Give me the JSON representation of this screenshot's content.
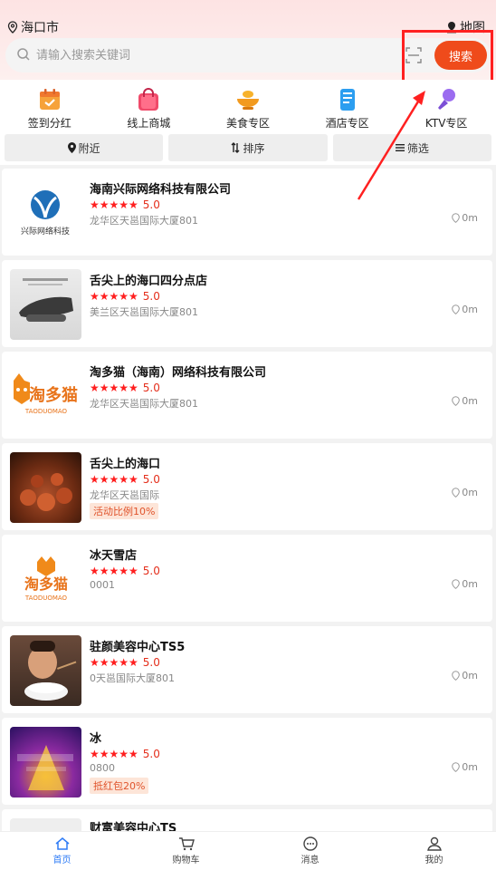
{
  "header": {
    "city": "海口市",
    "map_label": "地图",
    "search_placeholder": "请输入搜索关键词",
    "search_button": "搜索"
  },
  "categories": [
    {
      "label": "签到分红",
      "icon": "calendar-icon"
    },
    {
      "label": "线上商城",
      "icon": "shopping-bag-icon"
    },
    {
      "label": "美食专区",
      "icon": "food-bowl-icon"
    },
    {
      "label": "酒店专区",
      "icon": "hotel-building-icon"
    },
    {
      "label": "KTV专区",
      "icon": "microphone-icon"
    }
  ],
  "filters": [
    {
      "label": "附近",
      "icon": "location-pin-icon"
    },
    {
      "label": "排序",
      "icon": "sort-icon"
    },
    {
      "label": "筛选",
      "icon": "filter-icon"
    }
  ],
  "shops": [
    {
      "name": "海南兴际网络科技有限公司",
      "rating": "5.0",
      "address": "龙华区天邕国际大厦801",
      "distance": "0m",
      "tag": "",
      "logo_text": "兴际网络科技"
    },
    {
      "name": "舌尖上的海口四分点店",
      "rating": "5.0",
      "address": "美兰区天邕国际大厦801",
      "distance": "0m",
      "tag": ""
    },
    {
      "name": "淘多猫（海南）网络科技有限公司",
      "rating": "5.0",
      "address": "龙华区天邕国际大厦801",
      "distance": "0m",
      "tag": "",
      "logo_text": "淘多猫",
      "logo_sub": "TAODUOMAO"
    },
    {
      "name": "舌尖上的海口",
      "rating": "5.0",
      "address": "龙华区天邕国际",
      "distance": "0m",
      "tag": "活动比例10%"
    },
    {
      "name": "冰天雪店",
      "rating": "5.0",
      "address": "0001",
      "distance": "0m",
      "tag": "",
      "logo_text": "淘多猫",
      "logo_sub": "TAODUOMAO"
    },
    {
      "name": "驻颜美容中心TS5",
      "rating": "5.0",
      "address": "0天邕国际大厦801",
      "distance": "0m",
      "tag": ""
    },
    {
      "name": "冰",
      "rating": "5.0",
      "address": "0800",
      "distance": "0m",
      "tag": "抵红包20%"
    },
    {
      "name": "财富美容中心TS",
      "rating": "",
      "address": "",
      "distance": "",
      "tag": ""
    }
  ],
  "tabbar": [
    {
      "label": "首页",
      "icon": "home-icon",
      "active": true
    },
    {
      "label": "购物车",
      "icon": "cart-icon",
      "active": false
    },
    {
      "label": "消息",
      "icon": "message-icon",
      "active": false
    },
    {
      "label": "我的",
      "icon": "user-icon",
      "active": false
    }
  ],
  "colors": {
    "accent": "#ef4b1b",
    "star": "#ff1f1f",
    "active_tab": "#2f7cf6",
    "annotation": "#ff2020"
  }
}
